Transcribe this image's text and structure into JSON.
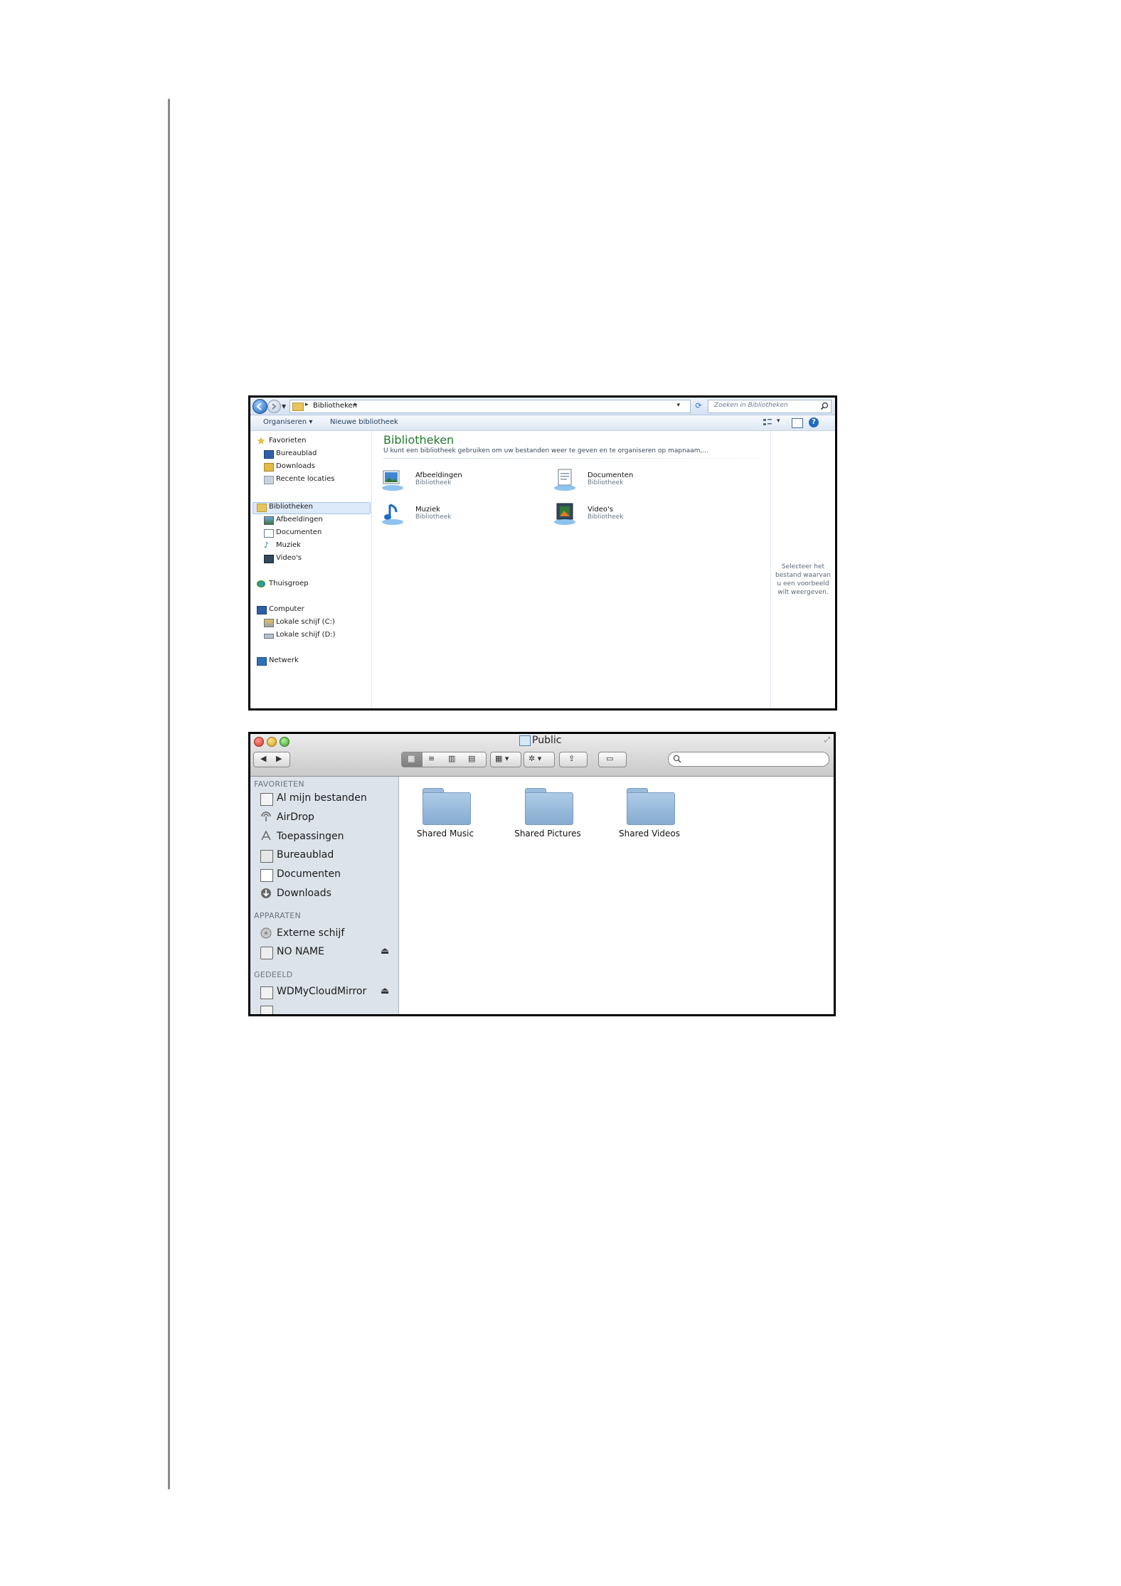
{
  "windows_explorer": {
    "breadcrumb": "Bibliotheken",
    "search_placeholder": "Zoeken in Bibliotheken",
    "toolbar": {
      "organize": "Organiseren ▾",
      "new_library": "Nieuwe bibliotheek"
    },
    "nav": {
      "favorites": "Favorieten",
      "desktop": "Bureaublad",
      "downloads": "Downloads",
      "recent": "Recente locaties",
      "libraries": "Bibliotheken",
      "pictures": "Afbeeldingen",
      "documents": "Documenten",
      "music": "Muziek",
      "videos": "Video's",
      "homegroup": "Thuisgroep",
      "computer": "Computer",
      "drive_c": "Lokale schijf (C:)",
      "drive_d": "Lokale schijf (D:)",
      "network": "Netwerk"
    },
    "main": {
      "title": "Bibliotheken",
      "description": "U kunt een bibliotheek gebruiken om uw bestanden weer te geven en te organiseren op mapnaam,...",
      "libraries": [
        {
          "name": "Afbeeldingen",
          "type": "Bibliotheek"
        },
        {
          "name": "Documenten",
          "type": "Bibliotheek"
        },
        {
          "name": "Muziek",
          "type": "Bibliotheek"
        },
        {
          "name": "Video's",
          "type": "Bibliotheek"
        }
      ]
    },
    "preview_text": "Selecteer het bestand waarvan u een voorbeeld wilt weergeven."
  },
  "mac_finder": {
    "title": "Public",
    "sidebar": {
      "favorites_header": "FAVORIETEN",
      "all_files": "Al mijn bestanden",
      "airdrop": "AirDrop",
      "applications": "Toepassingen",
      "desktop": "Bureaublad",
      "documents": "Documenten",
      "downloads": "Downloads",
      "devices_header": "APPARATEN",
      "external": "Externe schijf",
      "no_name": "NO NAME",
      "shared_header": "GEDEELD",
      "wd": "WDMyCloudMirror"
    },
    "folders": [
      "Shared Music",
      "Shared Pictures",
      "Shared Videos"
    ]
  }
}
